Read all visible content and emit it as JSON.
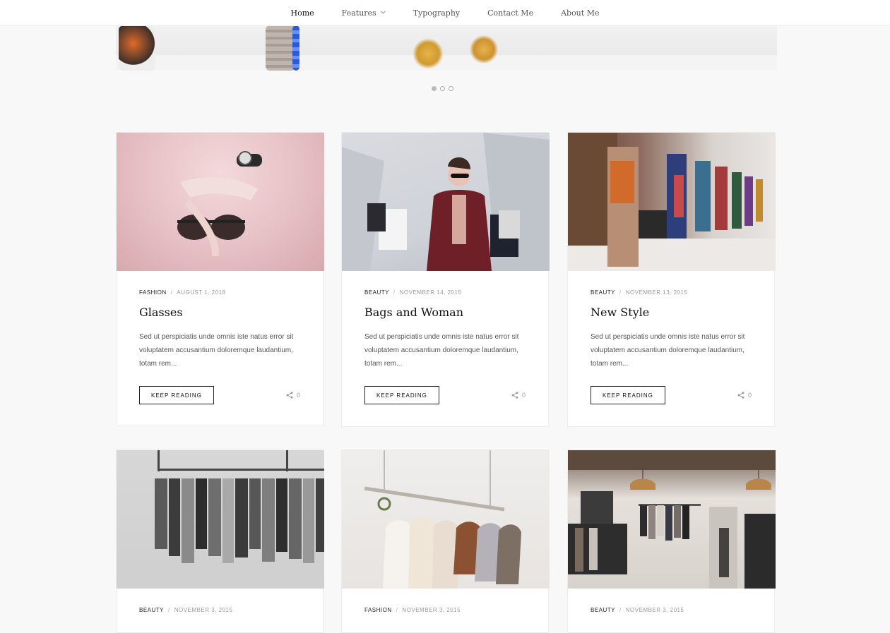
{
  "nav": {
    "items": [
      {
        "label": "Home"
      },
      {
        "label": "Features"
      },
      {
        "label": "Typography"
      },
      {
        "label": "Contact Me"
      },
      {
        "label": "About Me"
      }
    ]
  },
  "slider": {
    "slide_count": 3,
    "active_index": 0
  },
  "posts": [
    {
      "category": "FASHION",
      "date": "AUGUST 1, 2018",
      "title": "Glasses",
      "excerpt": "Sed ut perspiciatis unde omnis iste natus error sit voluptatem accusantium doloremque laudantium, totam rem...",
      "button": "KEEP READING",
      "shares": "0"
    },
    {
      "category": "BEAUTY",
      "date": "NOVEMBER 14, 2015",
      "title": "Bags and Woman",
      "excerpt": "Sed ut perspiciatis unde omnis iste natus error sit voluptatem accusantium doloremque laudantium, totam rem...",
      "button": "KEEP READING",
      "shares": "0"
    },
    {
      "category": "BEAUTY",
      "date": "NOVEMBER 13, 2015",
      "title": "New Style",
      "excerpt": "Sed ut perspiciatis unde omnis iste natus error sit voluptatem accusantium doloremque laudantium, totam rem...",
      "button": "KEEP READING",
      "shares": "0"
    },
    {
      "category": "BEAUTY",
      "date": "NOVEMBER 3, 2015"
    },
    {
      "category": "FASHION",
      "date": "NOVEMBER 3, 2015"
    },
    {
      "category": "BEAUTY",
      "date": "NOVEMBER 3, 2015"
    }
  ]
}
